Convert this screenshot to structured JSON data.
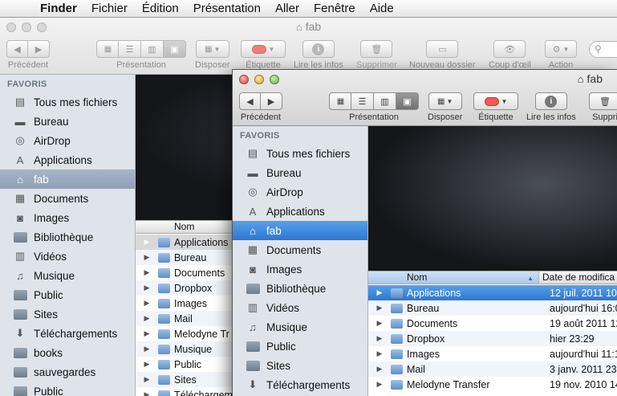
{
  "menubar": {
    "items": [
      "Finder",
      "Fichier",
      "Édition",
      "Présentation",
      "Aller",
      "Fenêtre",
      "Aide"
    ]
  },
  "window_back": {
    "title": "fab",
    "toolbar": {
      "previous": "Précédent",
      "view": "Présentation",
      "arrange": "Disposer",
      "label": "Étiquette",
      "get_info": "Lire les infos",
      "delete": "Supprimer",
      "new_folder": "Nouveau dossier",
      "quick_look": "Coup d'œil",
      "action": "Action"
    },
    "sidebar": {
      "heading": "FAVORIS",
      "items": [
        "Tous mes fichiers",
        "Bureau",
        "AirDrop",
        "Applications",
        "fab",
        "Documents",
        "Images",
        "Bibliothèque",
        "Vidéos",
        "Musique",
        "Public",
        "Sites",
        "Téléchargements",
        "books",
        "sauvegardes",
        "Public"
      ],
      "active": "fab"
    },
    "list": {
      "col_name": "Nom",
      "rows": [
        "Applications",
        "Bureau",
        "Documents",
        "Dropbox",
        "Images",
        "Mail",
        "Melodyne Tr",
        "Musique",
        "Public",
        "Sites",
        "Téléchargem"
      ]
    }
  },
  "window_front": {
    "title": "fab",
    "toolbar": {
      "previous": "Précédent",
      "view": "Présentation",
      "arrange": "Disposer",
      "label": "Étiquette",
      "get_info": "Lire les infos",
      "delete": "Suppri"
    },
    "sidebar": {
      "heading": "FAVORIS",
      "items": [
        "Tous mes fichiers",
        "Bureau",
        "AirDrop",
        "Applications",
        "fab",
        "Documents",
        "Images",
        "Bibliothèque",
        "Vidéos",
        "Musique",
        "Public",
        "Sites",
        "Téléchargements"
      ],
      "active": "fab"
    },
    "list": {
      "col_name": "Nom",
      "col_date": "Date de modifica",
      "rows": [
        {
          "name": "Applications",
          "date": "12 juil. 2011 10:"
        },
        {
          "name": "Bureau",
          "date": "aujourd'hui 16:0"
        },
        {
          "name": "Documents",
          "date": "19 août 2011 12:"
        },
        {
          "name": "Dropbox",
          "date": "hier 23:29"
        },
        {
          "name": "Images",
          "date": "aujourd'hui 11:1"
        },
        {
          "name": "Mail",
          "date": "3 janv. 2011 23:"
        },
        {
          "name": "Melodyne Transfer",
          "date": "19 nov. 2010 14:"
        }
      ]
    }
  },
  "colors": {
    "selection": "#2d77d4",
    "sidebar_bg": "#dee4ea",
    "label_red": "#f05a52"
  }
}
